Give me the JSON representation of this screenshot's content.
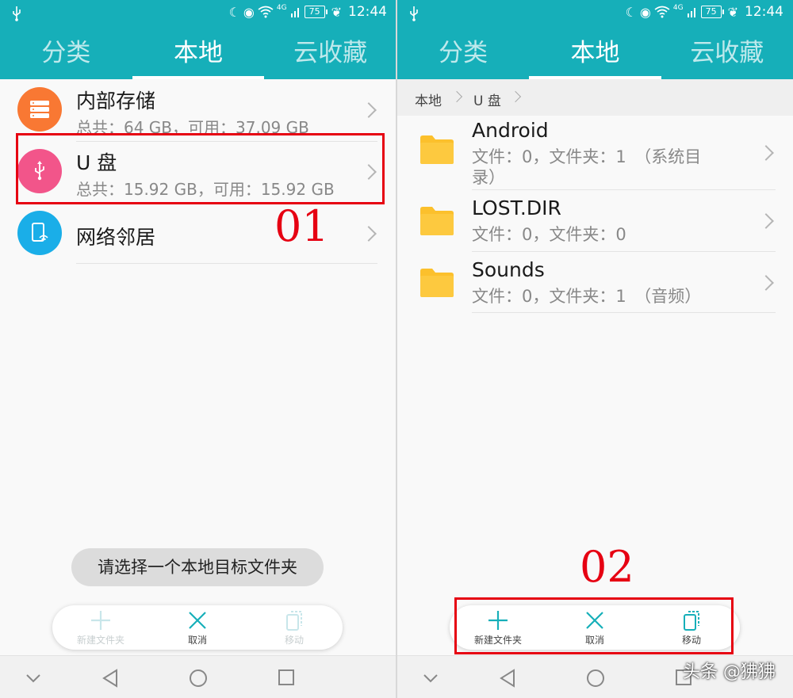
{
  "status_bar": {
    "network": "4G",
    "battery": "75",
    "time": "12:44"
  },
  "tabs": [
    "分类",
    "本地",
    "云收藏"
  ],
  "left": {
    "storage": [
      {
        "title": "内部存储",
        "subtitle": "总共：64 GB，可用：37.09 GB",
        "icon": "storage-icon",
        "color": "#f97833"
      },
      {
        "title": "U 盘",
        "subtitle": "总共：15.92 GB，可用：15.92 GB",
        "icon": "usb-icon",
        "color": "#f2558a"
      },
      {
        "title": "网络邻居",
        "icon": "network-neighbor-icon",
        "color": "#1aaee8"
      }
    ],
    "step_label": "01",
    "toast": "请选择一个本地目标文件夹"
  },
  "actions": {
    "new_folder": "新建文件夹",
    "cancel": "取消",
    "move": "移动"
  },
  "right": {
    "breadcrumb": [
      "本地",
      "U 盘"
    ],
    "folders": [
      {
        "name": "Android",
        "meta_line1": "文件：0，文件夹：1　（系统目",
        "meta_line2": "录）"
      },
      {
        "name": "LOST.DIR",
        "meta_line1": "文件：0，文件夹：0"
      },
      {
        "name": "Sounds",
        "meta_line1": "文件：0，文件夹：1　（音频）"
      }
    ],
    "step_label": "02"
  },
  "watermark": "头条 @狒狒",
  "colors": {
    "accent": "#16afb9",
    "annotation": "#e60012",
    "folder": "#fcc02c"
  }
}
